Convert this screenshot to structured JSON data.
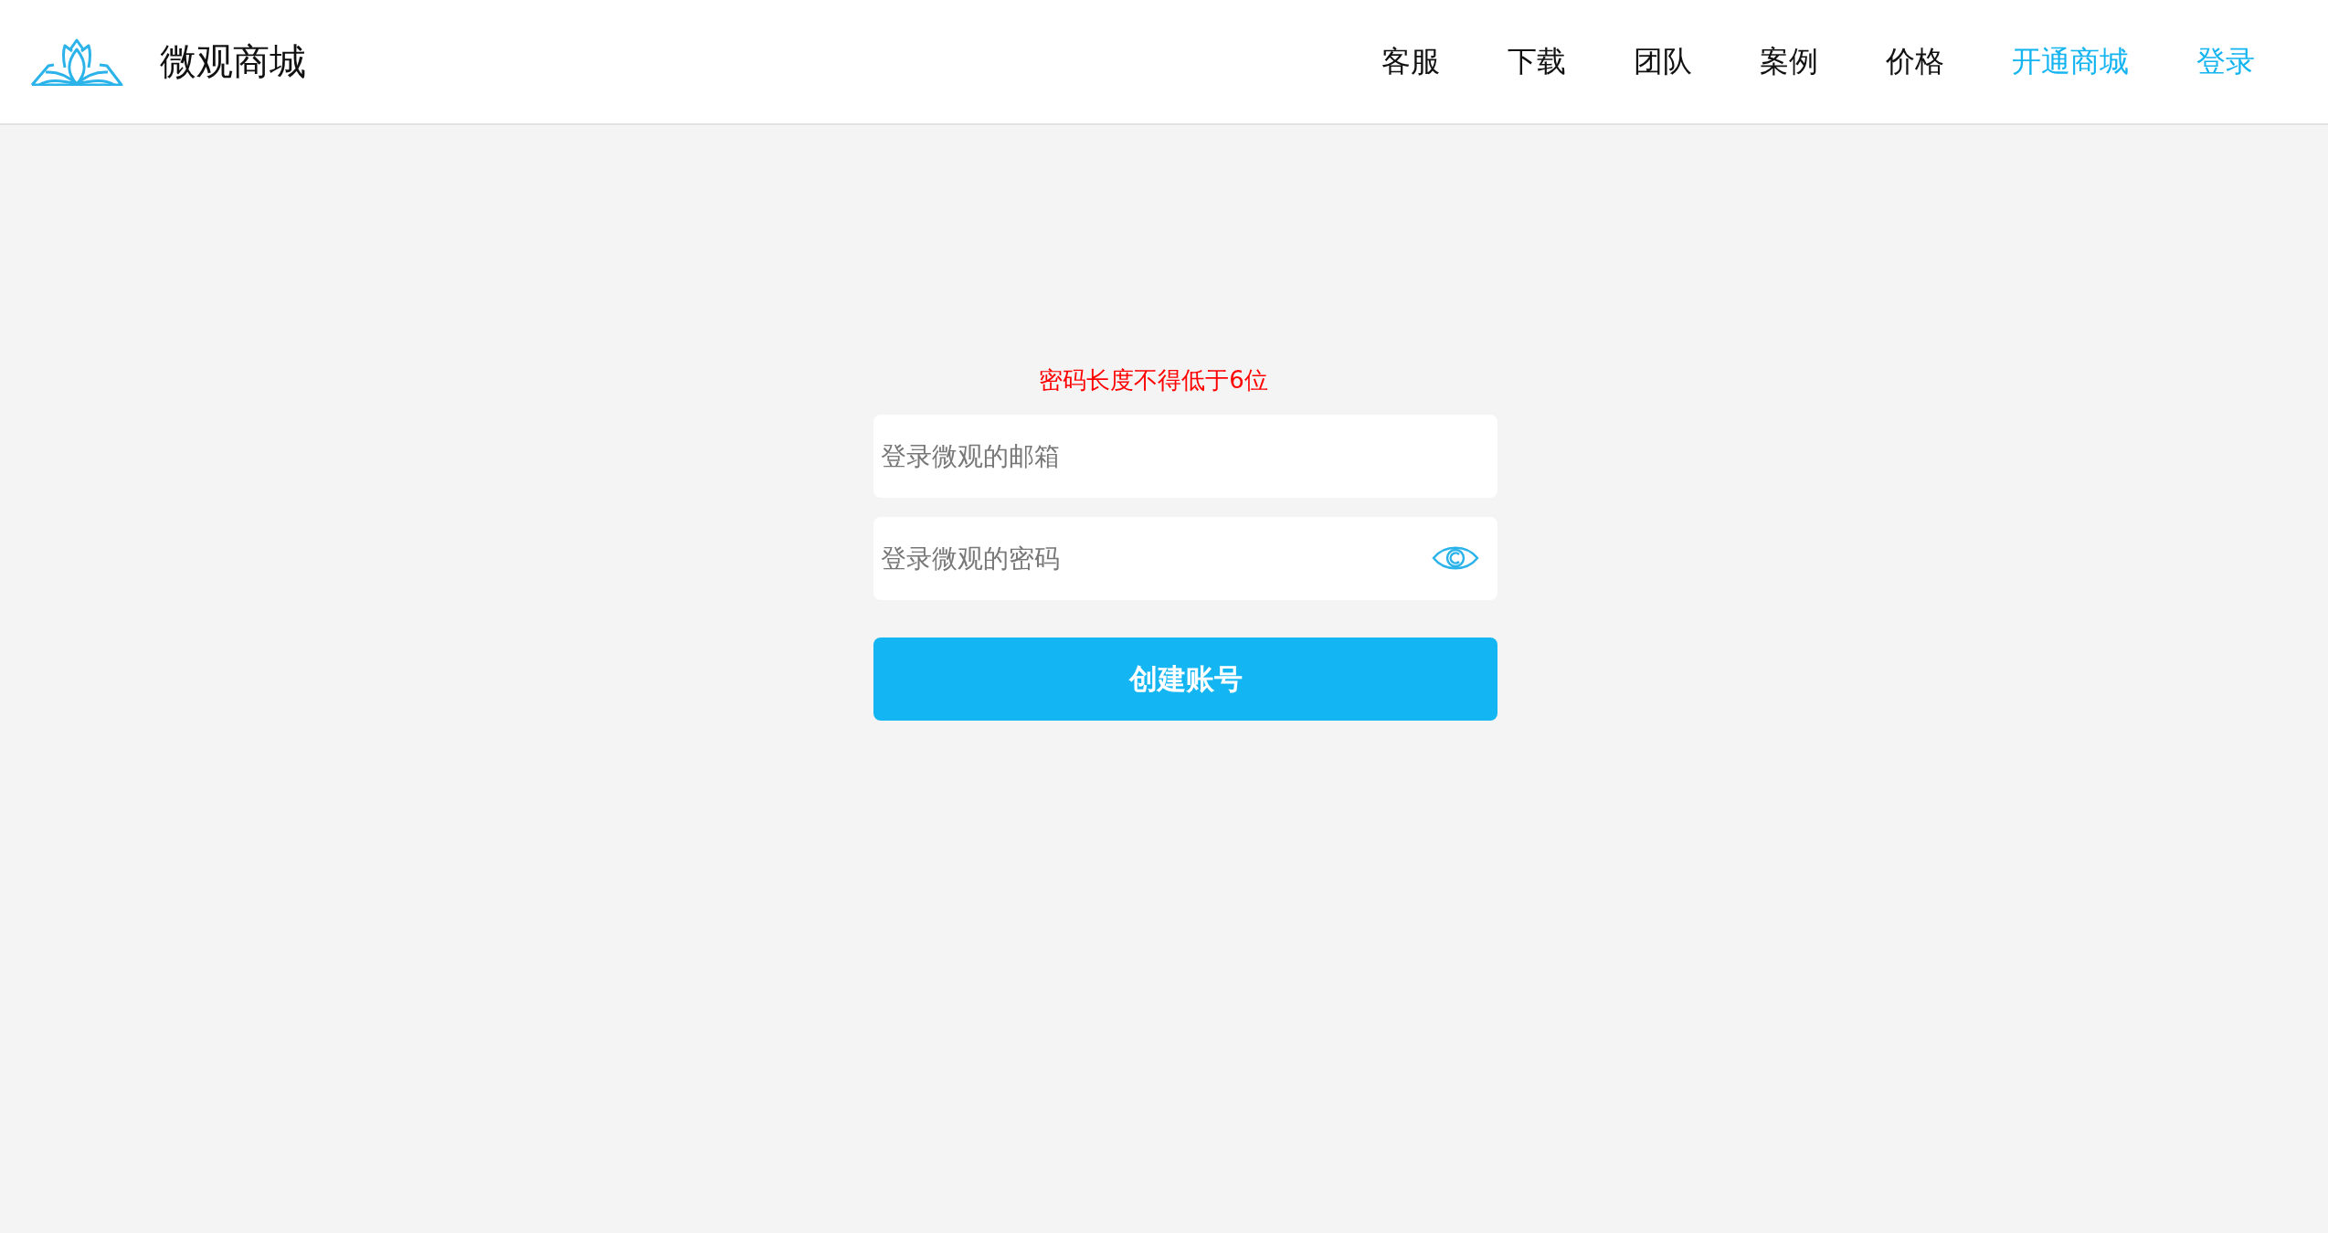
{
  "header": {
    "brand": "微观商城",
    "nav": [
      {
        "label": "客服",
        "highlighted": false
      },
      {
        "label": "下载",
        "highlighted": false
      },
      {
        "label": "团队",
        "highlighted": false
      },
      {
        "label": "案例",
        "highlighted": false
      },
      {
        "label": "价格",
        "highlighted": false
      },
      {
        "label": "开通商城",
        "highlighted": true
      },
      {
        "label": "登录",
        "highlighted": true
      }
    ]
  },
  "form": {
    "error": "密码长度不得低于6位",
    "email": {
      "placeholder": "登录微观的邮箱"
    },
    "password": {
      "placeholder": "登录微观的密码"
    },
    "submit": "创建账号"
  }
}
